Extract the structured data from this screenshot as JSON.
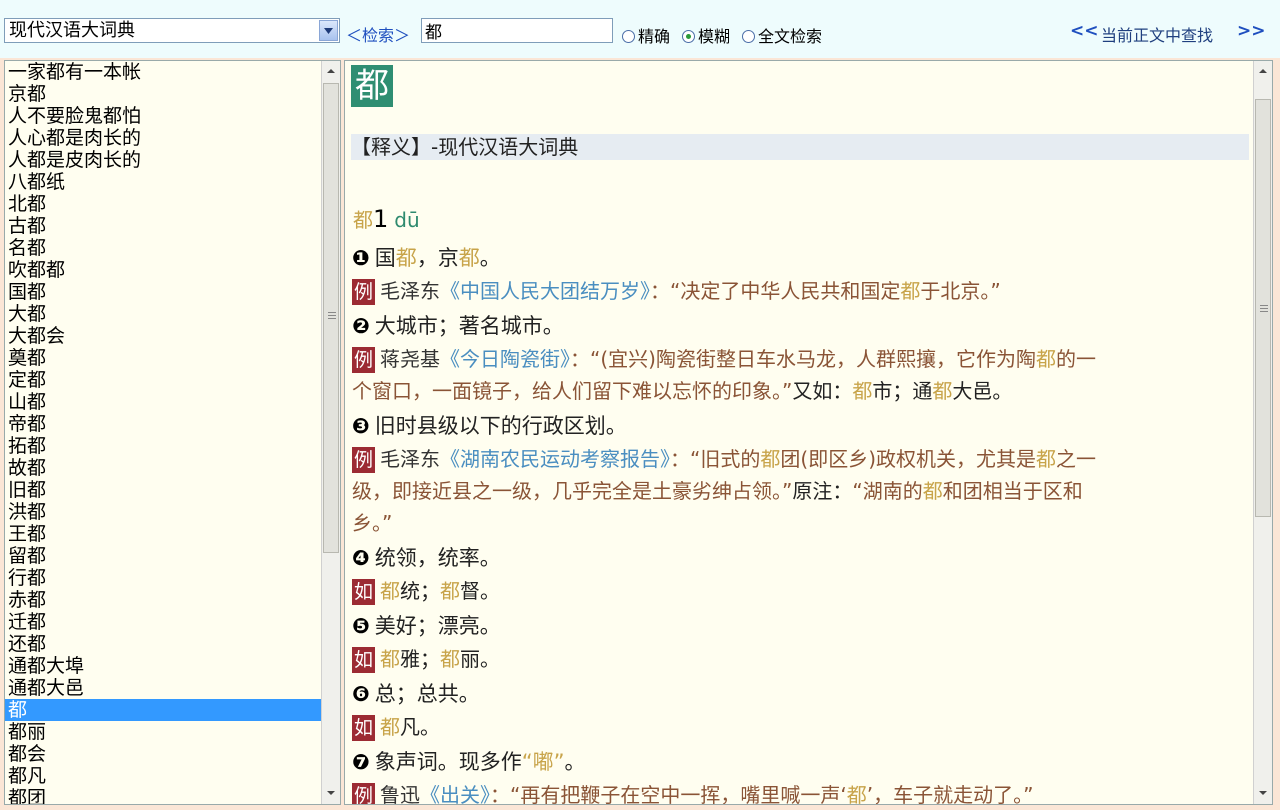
{
  "toolbar": {
    "dictionary_select": "现代汉语大词典",
    "search_label": "＜检索＞",
    "search_value": "都",
    "mode_exact": "精确",
    "mode_fuzzy": "模糊",
    "mode_fulltext": "全文检索",
    "selected_mode": "模糊",
    "nav_prev": "<<",
    "nav_label": "当前正文中查找",
    "nav_next": ">>"
  },
  "word_list": {
    "items": [
      "一家都有一本帐",
      "京都",
      "人不要脸鬼都怕",
      "人心都是肉长的",
      "人都是皮肉长的",
      "八都纸",
      "北都",
      "古都",
      "名都",
      "吹都都",
      "国都",
      "大都",
      "大都会",
      "奠都",
      "定都",
      "山都",
      "帝都",
      "拓都",
      "故都",
      "旧都",
      "洪都",
      "王都",
      "留都",
      "行都",
      "赤都",
      "迁都",
      "还都",
      "通都大埠",
      "通都大邑",
      "都",
      "都丽",
      "都会",
      "都凡",
      "都团"
    ],
    "selected": "都"
  },
  "content": {
    "headword": "都",
    "definition_bar": "【释义】-现代汉语大词典",
    "entry_char": "都",
    "entry_num": "1",
    "pinyin": "dū",
    "senses": [
      {
        "num": "❶",
        "segments": [
          {
            "t": "国",
            "c": "plain"
          },
          {
            "t": "都",
            "c": "hl"
          },
          {
            "t": "，京",
            "c": "plain"
          },
          {
            "t": "都",
            "c": "hl"
          },
          {
            "t": "。",
            "c": "plain"
          }
        ],
        "examples": [
          {
            "tag": "例",
            "lines": [
              [
                {
                  "t": "毛泽东",
                  "c": "author"
                },
                {
                  "t": "《中国人民大团结万岁》",
                  "c": "work"
                },
                {
                  "t": "：“决定了中华人民共和国定",
                  "c": "quote"
                },
                {
                  "t": "都",
                  "c": "hl"
                },
                {
                  "t": "于北京。”",
                  "c": "quote"
                }
              ]
            ]
          }
        ]
      },
      {
        "num": "❷",
        "segments": [
          {
            "t": "大城市；著名城市。",
            "c": "plain"
          }
        ],
        "examples": [
          {
            "tag": "例",
            "lines": [
              [
                {
                  "t": "蒋尧基",
                  "c": "author"
                },
                {
                  "t": "《今日陶瓷街》",
                  "c": "work"
                },
                {
                  "t": "：“(宜兴)陶瓷街整日车水马龙，人群熙攘，它作为陶",
                  "c": "quote"
                },
                {
                  "t": "都",
                  "c": "hl"
                },
                {
                  "t": "的一",
                  "c": "quote"
                }
              ],
              [
                {
                  "t": "个窗口，一面镜子，给人们留下难以忘怀的印象。”",
                  "c": "quote"
                },
                {
                  "t": "又如：",
                  "c": "plain"
                },
                {
                  "t": "都",
                  "c": "hl"
                },
                {
                  "t": "市；通",
                  "c": "plain"
                },
                {
                  "t": "都",
                  "c": "hl"
                },
                {
                  "t": "大邑。",
                  "c": "plain"
                }
              ]
            ]
          }
        ]
      },
      {
        "num": "❸",
        "segments": [
          {
            "t": "旧时县级以下的行政区划。",
            "c": "plain"
          }
        ],
        "examples": [
          {
            "tag": "例",
            "lines": [
              [
                {
                  "t": "毛泽东",
                  "c": "author"
                },
                {
                  "t": "《湖南农民运动考察报告》",
                  "c": "work"
                },
                {
                  "t": "：“旧式的",
                  "c": "quote"
                },
                {
                  "t": "都",
                  "c": "hl"
                },
                {
                  "t": "团(即区乡)政权机关，尤其是",
                  "c": "quote"
                },
                {
                  "t": "都",
                  "c": "hl"
                },
                {
                  "t": "之一",
                  "c": "quote"
                }
              ],
              [
                {
                  "t": "级，即接近县之一级，几乎完全是土豪劣绅占领。”",
                  "c": "quote"
                },
                {
                  "t": "原注：",
                  "c": "plain"
                },
                {
                  "t": "“湖南的",
                  "c": "quote"
                },
                {
                  "t": "都",
                  "c": "hl"
                },
                {
                  "t": "和团相当于区和",
                  "c": "quote"
                }
              ],
              [
                {
                  "t": "乡。”",
                  "c": "quote"
                }
              ]
            ]
          }
        ]
      },
      {
        "num": "❹",
        "segments": [
          {
            "t": "统领，统率。",
            "c": "plain"
          }
        ],
        "examples": [
          {
            "tag": "如",
            "lines": [
              [
                {
                  "t": "都",
                  "c": "hl"
                },
                {
                  "t": "统；",
                  "c": "plain"
                },
                {
                  "t": "都",
                  "c": "hl"
                },
                {
                  "t": "督。",
                  "c": "plain"
                }
              ]
            ]
          }
        ]
      },
      {
        "num": "❺",
        "segments": [
          {
            "t": "美好；漂亮。",
            "c": "plain"
          }
        ],
        "examples": [
          {
            "tag": "如",
            "lines": [
              [
                {
                  "t": "都",
                  "c": "hl"
                },
                {
                  "t": "雅；",
                  "c": "plain"
                },
                {
                  "t": "都",
                  "c": "hl"
                },
                {
                  "t": "丽。",
                  "c": "plain"
                }
              ]
            ]
          }
        ]
      },
      {
        "num": "❻",
        "segments": [
          {
            "t": "总；总共。",
            "c": "plain"
          }
        ],
        "examples": [
          {
            "tag": "如",
            "lines": [
              [
                {
                  "t": "都",
                  "c": "hl"
                },
                {
                  "t": "凡。",
                  "c": "plain"
                }
              ]
            ]
          }
        ]
      },
      {
        "num": "❼",
        "segments": [
          {
            "t": "象声词。现多作",
            "c": "plain"
          },
          {
            "t": "“嘟”",
            "c": "hl"
          },
          {
            "t": "。",
            "c": "plain"
          }
        ],
        "examples": [
          {
            "tag": "例",
            "lines": [
              [
                {
                  "t": "鲁迅",
                  "c": "author"
                },
                {
                  "t": "《出关》",
                  "c": "work"
                },
                {
                  "t": "：“再有把鞭子在空中一挥，嘴里喊一声‘",
                  "c": "quote"
                },
                {
                  "t": "都",
                  "c": "hl"
                },
                {
                  "t": "’，车子就走动了。”",
                  "c": "quote"
                }
              ]
            ]
          }
        ]
      }
    ]
  },
  "colors": {
    "headword_bg": "#2f8e72",
    "highlight": "#c8a44a",
    "work_title": "#4a8ec0",
    "quote": "#8a5436",
    "tag_bg": "#9c2b33",
    "list_selected": "#3399ff"
  }
}
